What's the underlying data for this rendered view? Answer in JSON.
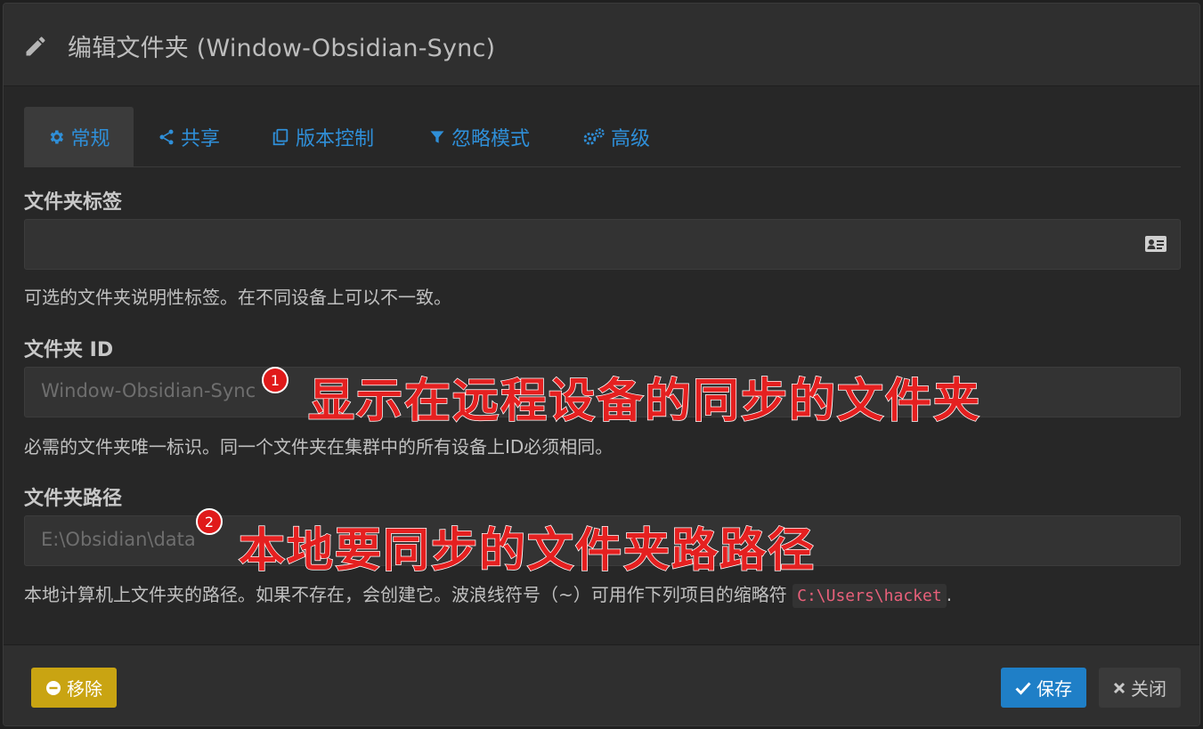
{
  "dialog": {
    "title": "编辑文件夹 (Window-Obsidian-Sync)",
    "header_icon": "pencil-icon"
  },
  "tabs": [
    {
      "label": "常规",
      "icon": "gear-icon",
      "active": true
    },
    {
      "label": "共享",
      "icon": "share-icon",
      "active": false
    },
    {
      "label": "版本控制",
      "icon": "copy-icon",
      "active": false
    },
    {
      "label": "忽略模式",
      "icon": "filter-icon",
      "active": false
    },
    {
      "label": "高级",
      "icon": "cogs-icon",
      "active": false
    }
  ],
  "fields": {
    "folder_label": {
      "label": "文件夹标签",
      "value": "",
      "help": "可选的文件夹说明性标签。在不同设备上可以不一致。",
      "icon": "id-card-icon"
    },
    "folder_id": {
      "label": "文件夹 ID",
      "value": "Window-Obsidian-Sync",
      "help": "必需的文件夹唯一标识。同一个文件夹在集群中的所有设备上ID必须相同。"
    },
    "folder_path": {
      "label": "文件夹路径",
      "value": "E:\\Obsidian\\data",
      "help_prefix": "本地计算机上文件夹的路径。如果不存在，会创建它。波浪线符号（~）可用作下列项目的缩略符",
      "help_code": "C:\\Users\\hacket",
      "help_suffix": "."
    }
  },
  "annotations": [
    {
      "number": "1",
      "text": "显示在远程设备的同步的文件夹"
    },
    {
      "number": "2",
      "text": "本地要同步的文件夹路路径"
    }
  ],
  "footer": {
    "remove_label": "移除",
    "save_label": "保存",
    "close_label": "关闭"
  },
  "colors": {
    "accent": "#2f8fd8",
    "save": "#1f7fc7",
    "remove": "#c9a412",
    "annotation": "#e52020"
  }
}
